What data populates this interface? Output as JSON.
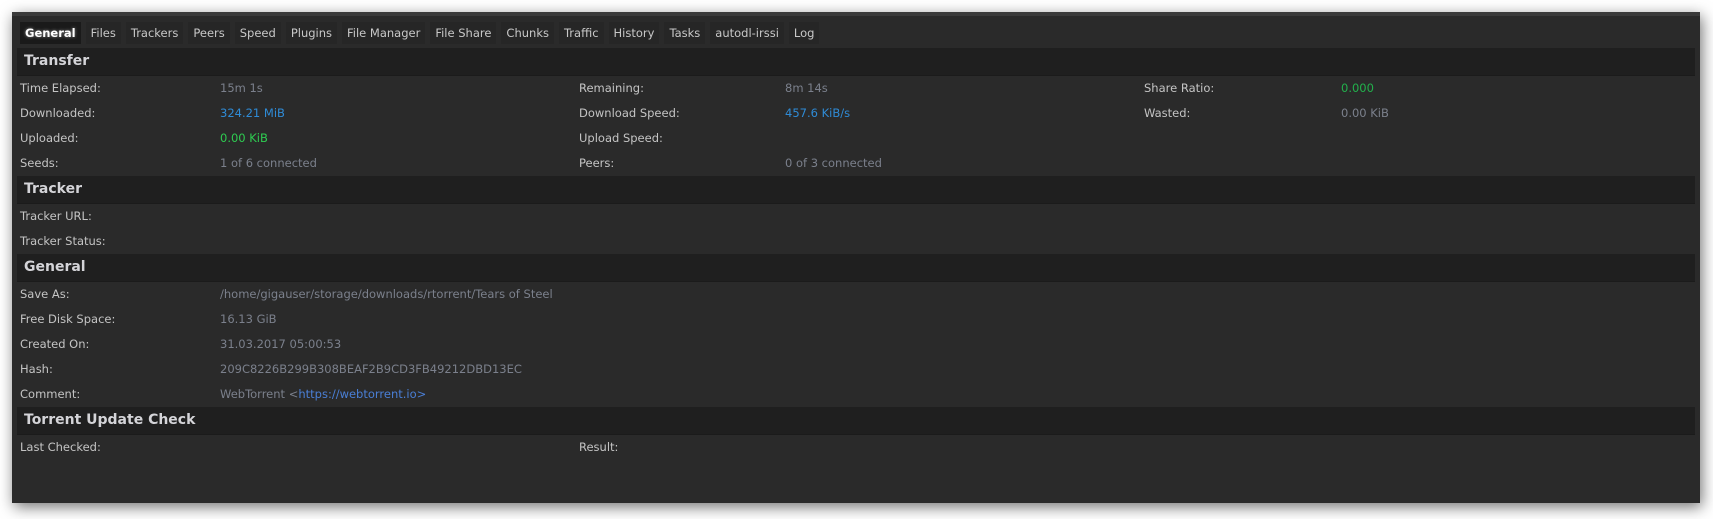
{
  "tabs": [
    {
      "label": "General",
      "active": true
    },
    {
      "label": "Files"
    },
    {
      "label": "Trackers"
    },
    {
      "label": "Peers"
    },
    {
      "label": "Speed"
    },
    {
      "label": "Plugins"
    },
    {
      "label": "File Manager"
    },
    {
      "label": "File Share"
    },
    {
      "label": "Chunks"
    },
    {
      "label": "Traffic"
    },
    {
      "label": "History"
    },
    {
      "label": "Tasks"
    },
    {
      "label": "autodl-irssi"
    },
    {
      "label": "Log"
    }
  ],
  "transfer": {
    "title": "Transfer",
    "time_elapsed": {
      "label": "Time Elapsed:",
      "value": "15m 1s"
    },
    "remaining": {
      "label": "Remaining:",
      "value": "8m 14s"
    },
    "share_ratio": {
      "label": "Share Ratio:",
      "value": "0.000"
    },
    "downloaded": {
      "label": "Downloaded:",
      "value": "324.21 MiB"
    },
    "download_speed": {
      "label": "Download Speed:",
      "value": "457.6 KiB/s"
    },
    "wasted": {
      "label": "Wasted:",
      "value": "0.00 KiB"
    },
    "uploaded": {
      "label": "Uploaded:",
      "value": "0.00 KiB"
    },
    "upload_speed": {
      "label": "Upload Speed:",
      "value": ""
    },
    "seeds": {
      "label": "Seeds:",
      "value": "1 of 6 connected"
    },
    "peers": {
      "label": "Peers:",
      "value": "0 of 3 connected"
    }
  },
  "tracker": {
    "title": "Tracker",
    "url": {
      "label": "Tracker URL:",
      "value": ""
    },
    "status": {
      "label": "Tracker Status:",
      "value": ""
    }
  },
  "general": {
    "title": "General",
    "save_as": {
      "label": "Save As:",
      "value": "/home/gigauser/storage/downloads/rtorrent/Tears of Steel"
    },
    "free_disk": {
      "label": "Free Disk Space:",
      "value": "16.13 GiB"
    },
    "created_on": {
      "label": "Created On:",
      "value": "31.03.2017 05:00:53"
    },
    "hash": {
      "label": "Hash:",
      "value": "209C8226B299B308BEAF2B9CD3FB49212DBD13EC"
    },
    "comment": {
      "label": "Comment:",
      "prefix": "WebTorrent <",
      "link": "https://webtorrent.io",
      "suffix": ">"
    }
  },
  "update_check": {
    "title": "Torrent Update Check",
    "last_checked": {
      "label": "Last Checked:",
      "value": ""
    },
    "result": {
      "label": "Result:",
      "value": ""
    }
  },
  "colors": {
    "accent_blue": "#2f8bd6",
    "accent_green": "#2ecc51",
    "link": "#4a7fd6",
    "background": "#2a2a2a",
    "section_header": "#1f1f1f"
  }
}
